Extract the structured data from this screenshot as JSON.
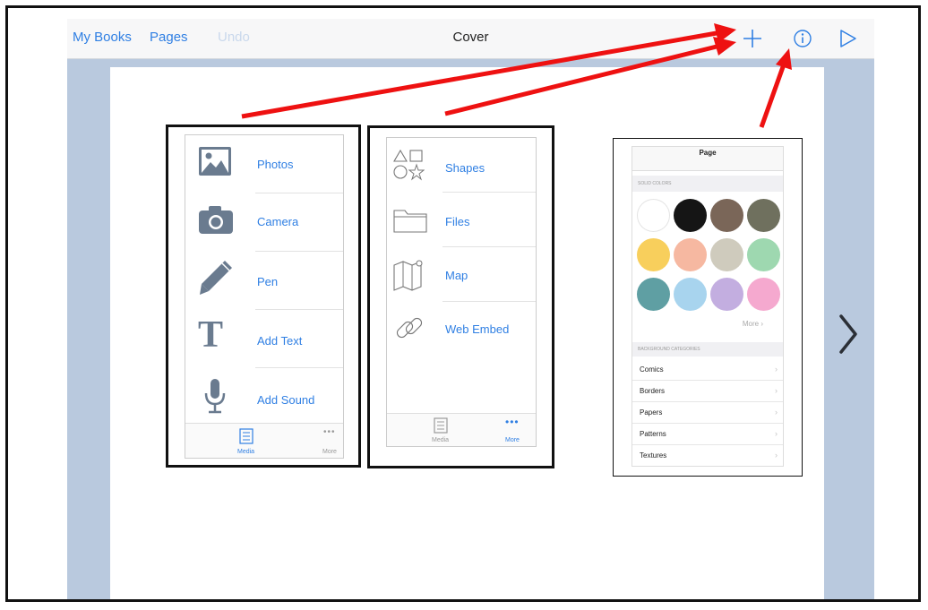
{
  "nav": {
    "my_books": "My Books",
    "pages": "Pages",
    "undo": "Undo",
    "title": "Cover",
    "icons": [
      "plus-icon",
      "info-icon",
      "play-icon"
    ]
  },
  "media_menu": {
    "items": [
      {
        "label": "Photos",
        "icon": "photos-icon"
      },
      {
        "label": "Camera",
        "icon": "camera-icon"
      },
      {
        "label": "Pen",
        "icon": "pen-icon"
      },
      {
        "label": "Add Text",
        "icon": "text-icon"
      },
      {
        "label": "Add Sound",
        "icon": "microphone-icon"
      }
    ],
    "tabs": [
      {
        "label": "Media",
        "icon": "list-icon",
        "active": true
      },
      {
        "label": "More",
        "icon": "more-icon",
        "active": false
      }
    ]
  },
  "more_menu": {
    "items": [
      {
        "label": "Shapes",
        "icon": "shapes-icon"
      },
      {
        "label": "Files",
        "icon": "folder-icon"
      },
      {
        "label": "Map",
        "icon": "map-icon"
      },
      {
        "label": "Web Embed",
        "icon": "link-icon"
      }
    ],
    "tabs": [
      {
        "label": "Media",
        "icon": "list-icon",
        "active": false
      },
      {
        "label": "More",
        "icon": "more-icon",
        "active": true
      }
    ]
  },
  "page_panel": {
    "title": "Page",
    "solid_colors_header": "SOLID COLORS",
    "colors": [
      "#ffffff",
      "#151515",
      "#7a6658",
      "#6f705e",
      "#f8cf5c",
      "#f6b8a1",
      "#cfcbbd",
      "#9ed8b0",
      "#5f9fa3",
      "#a8d4ee",
      "#c3aee0",
      "#f5a9cf"
    ],
    "more_label": "More",
    "background_header": "BACKGROUND CATEGORIES",
    "categories": [
      "Comics",
      "Borders",
      "Papers",
      "Patterns",
      "Textures"
    ]
  },
  "colors": {
    "accent": "#2f7fe3",
    "annotation": "#ee1111",
    "app_background": "#b9c9de"
  }
}
